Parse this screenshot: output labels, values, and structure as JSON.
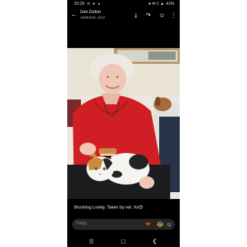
{
  "status_bar": {
    "time": "20:29",
    "left_icons": "✉ ★ ●",
    "battery": "41%",
    "right_icons": "● ✉ ‡ ▲"
  },
  "header": {
    "sender_name": "Dee Dutton",
    "timestamp": "16/09/2022, 10:27",
    "back_glyph": "←",
    "download_glyph": "⤓",
    "share_glyph": "↷",
    "emoji_glyph": "☺",
    "more_glyph": "⋮"
  },
  "message": {
    "caption": "Brushing  Lovely. Taken by vet. Xx😍"
  },
  "reply": {
    "placeholder": "Reply",
    "heart_emoji": "❤",
    "laugh_emoji": "😂",
    "add_reaction_glyph": "☺"
  },
  "nav": {
    "recents_glyph": "|||",
    "home_glyph": "▢",
    "back_glyph": "❮"
  },
  "colors": {
    "background": "#000000",
    "reply_bar": "#262626",
    "heart": "#e53935"
  }
}
